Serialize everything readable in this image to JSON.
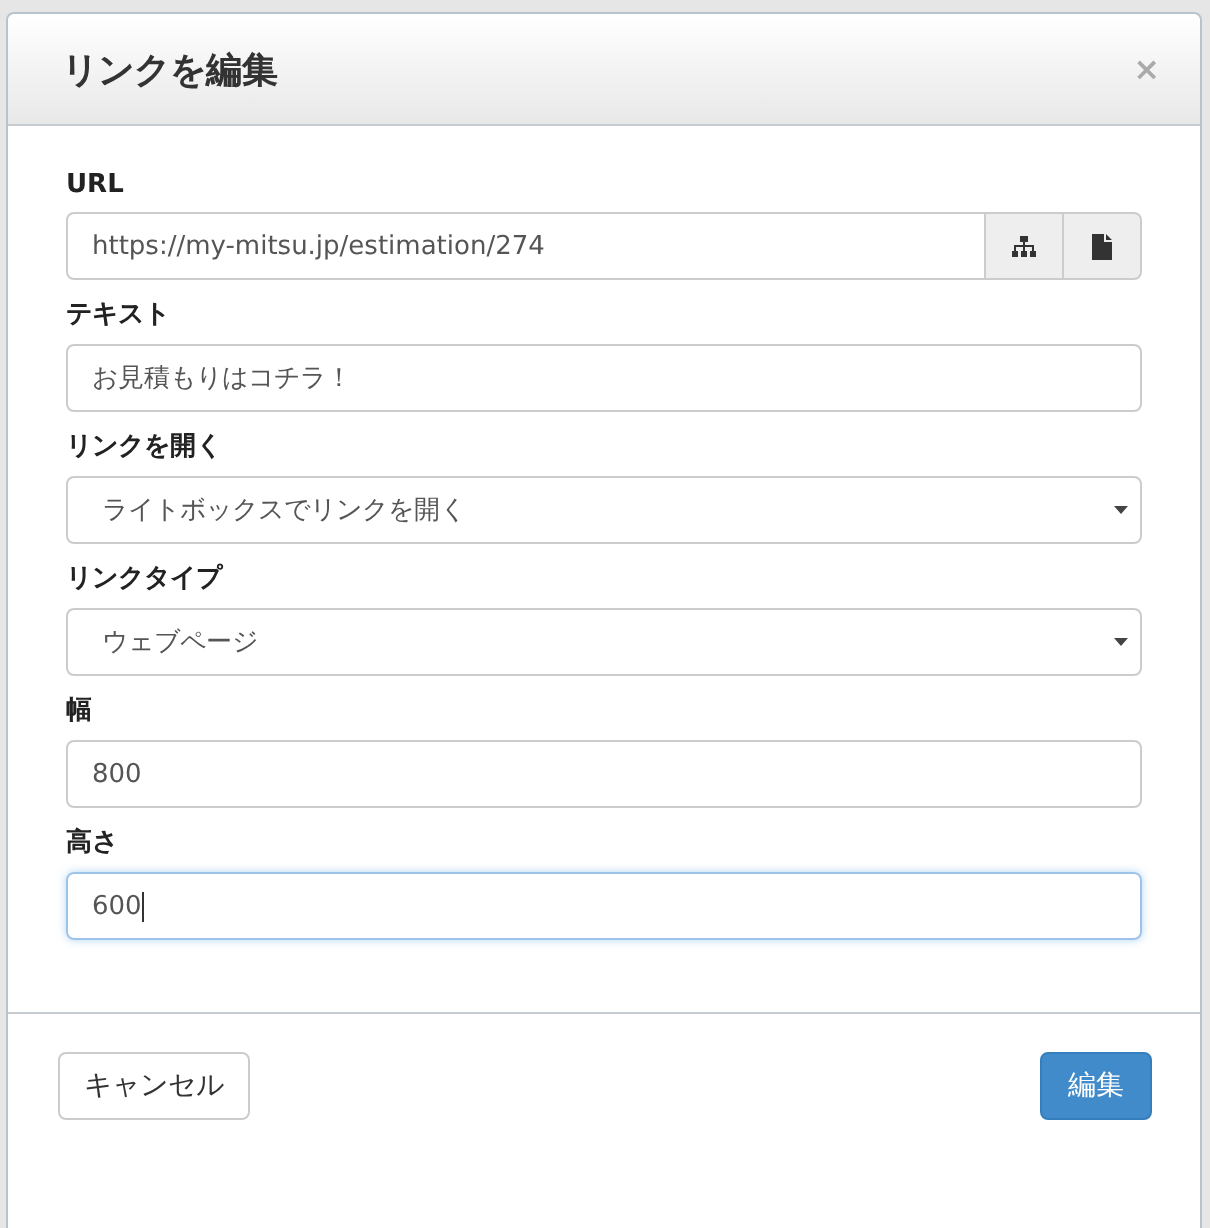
{
  "dialog": {
    "title": "リンクを編集",
    "close": "×"
  },
  "fields": [
    {
      "kind": "url",
      "label": "URL",
      "value": "https://my-mitsu.jp/estimation/274",
      "focused": false
    },
    {
      "kind": "text",
      "label": "テキスト",
      "value": "お見積もりはコチラ！",
      "focused": false
    },
    {
      "kind": "select",
      "label": "リンクを開く",
      "value": "ライトボックスでリンクを開く",
      "focused": false
    },
    {
      "kind": "select",
      "label": "リンクタイプ",
      "value": "ウェブページ",
      "focused": false
    },
    {
      "kind": "text",
      "label": "幅",
      "value": "800",
      "focused": false
    },
    {
      "kind": "text",
      "label": "高さ",
      "value": "600",
      "focused": true
    }
  ],
  "buttons": {
    "cancel": "キャンセル",
    "submit": "編集"
  }
}
